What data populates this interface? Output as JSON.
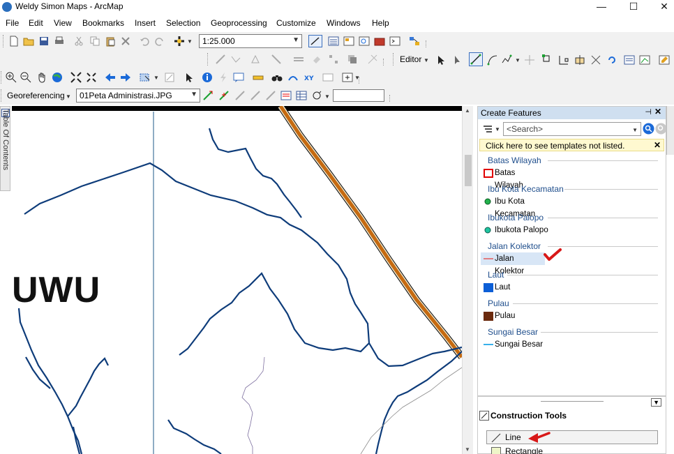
{
  "window": {
    "title": "Weldy Simon Maps - ArcMap",
    "controls": {
      "minimize": "—",
      "maximize": "☐",
      "close": "✕"
    }
  },
  "menu": {
    "items": [
      "File",
      "Edit",
      "View",
      "Bookmarks",
      "Insert",
      "Selection",
      "Geoprocessing",
      "Customize",
      "Windows",
      "Help"
    ]
  },
  "toolbar": {
    "scale_value": "1:25.000",
    "editor_label": "Editor",
    "georef_label": "Georeferencing",
    "georef_layer": "01Peta Administrasi.JPG",
    "georef_input": ""
  },
  "toc": {
    "label": "Table Of Contents"
  },
  "map": {
    "label_text": "UWU"
  },
  "create_features": {
    "title": "Create Features",
    "pin": "⊣",
    "close": "✕",
    "search_placeholder": "<Search>",
    "notice": "Click here to see templates not listed.",
    "notice_close": "✕",
    "groups": [
      {
        "title": "Batas Wilayah",
        "template": "Batas Wilayah",
        "symbol": "polygon-outline",
        "color": "#e00000"
      },
      {
        "title": "Ibu Kota Kecamatan",
        "template": "Ibu Kota Kecamatan",
        "symbol": "point",
        "color": "#22b14c"
      },
      {
        "title": "Ibukota Palopo",
        "template": "Ibukota Palopo",
        "symbol": "point",
        "color": "#1fc4a0"
      },
      {
        "title": "Jalan Kolektor",
        "template": "Jalan Kolektor",
        "symbol": "line",
        "color": "#e35a5a",
        "selected": true
      },
      {
        "title": "Laut",
        "template": "Laut",
        "symbol": "polygon-fill",
        "color": "#0c5ed6"
      },
      {
        "title": "Pulau",
        "template": "Pulau",
        "symbol": "polygon-fill",
        "color": "#6b2a0e"
      },
      {
        "title": "Sungai Besar",
        "template": "Sungai Besar",
        "symbol": "line",
        "color": "#22a7e8"
      }
    ]
  },
  "construction_tools": {
    "title": "Construction Tools",
    "items": [
      {
        "label": "Line",
        "active": true
      },
      {
        "label": "Rectangle",
        "active": false
      }
    ]
  }
}
